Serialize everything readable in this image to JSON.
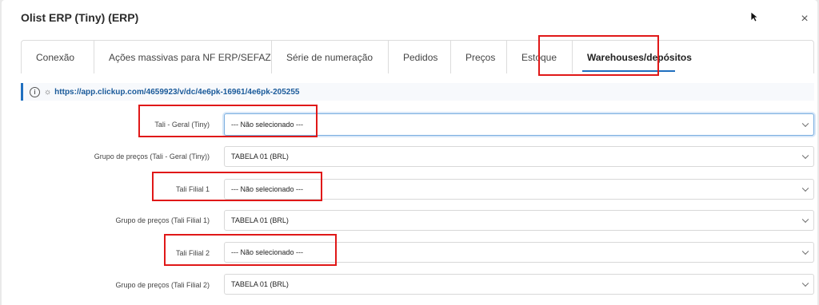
{
  "modal": {
    "title": "Olist ERP (Tiny) (ERP)",
    "close_icon": "×"
  },
  "tabs": [
    {
      "label": "Conexão"
    },
    {
      "label": "Ações massivas para NF ERP/SEFAZ"
    },
    {
      "label": "Série de numeração"
    },
    {
      "label": "Pedidos"
    },
    {
      "label": "Preços"
    },
    {
      "label": "Estoque"
    },
    {
      "label": "Warehouses/depósitos",
      "active": true
    }
  ],
  "info": {
    "icon": "i",
    "bug_icon": "☼",
    "url": "https://app.clickup.com/4659923/v/dc/4e6pk-16961/4e6pk-205255"
  },
  "fields": [
    {
      "label": "Tali - Geral (Tiny)",
      "value": "--- Não selecionado ---"
    },
    {
      "label": "Grupo de preços (Tali - Geral (Tiny))",
      "value": "TABELA 01 (BRL)"
    },
    {
      "label": "Tali Filial 1",
      "value": "--- Não selecionado ---"
    },
    {
      "label": "Grupo de preços (Tali Filial 1)",
      "value": "TABELA 01 (BRL)"
    },
    {
      "label": "Tali Filial 2",
      "value": "--- Não selecionado ---"
    },
    {
      "label": "Grupo de preços (Tali Filial 2)",
      "value": "TABELA 01 (BRL)"
    }
  ],
  "colors": {
    "accent": "#1f6fbf",
    "highlight": "#e01818"
  }
}
